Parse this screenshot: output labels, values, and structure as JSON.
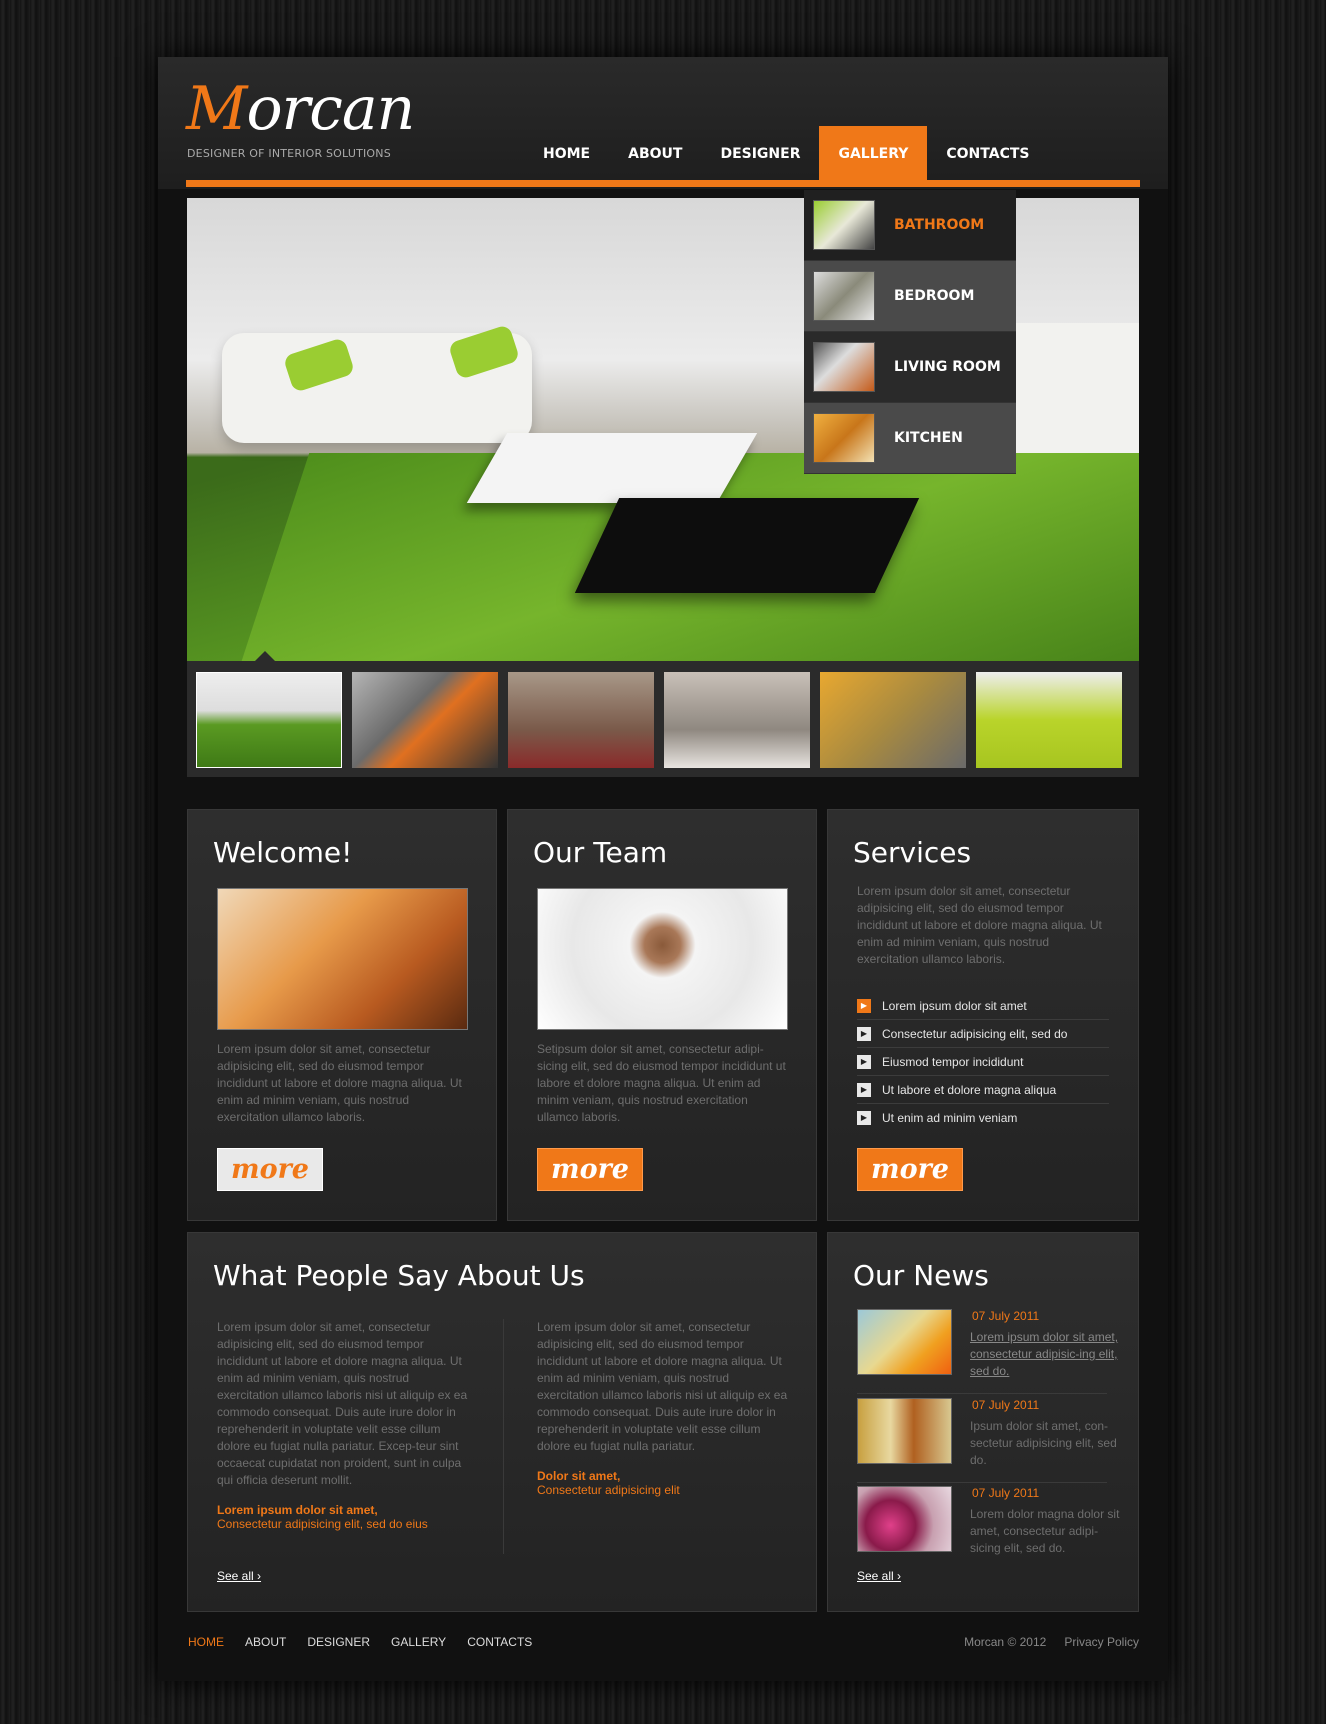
{
  "brand": {
    "name": "Morcan",
    "initial": "M",
    "rest": "orcan",
    "tagline": "DESIGNER OF INTERIOR SOLUTIONS",
    "accent": "#f07818"
  },
  "nav": {
    "items": [
      "HOME",
      "ABOUT",
      "DESIGNER",
      "GALLERY",
      "CONTACTS"
    ],
    "active": "GALLERY"
  },
  "gallery_menu": {
    "items": [
      "BATHROOM",
      "BEDROOM",
      "LIVING ROOM",
      "KITCHEN"
    ],
    "highlighted": "BATHROOM"
  },
  "welcome": {
    "title": "Welcome!",
    "text": "Lorem ipsum dolor sit amet, consectetur adipisicing elit, sed do eiusmod tempor incididunt ut labore et dolore magna aliqua. Ut enim ad minim veniam, quis nostrud exercitation ullamco laboris.",
    "more": "more"
  },
  "team": {
    "title": "Our Team",
    "text": "Setipsum dolor sit amet, consectetur adipi-sicing elit, sed do eiusmod tempor incididunt ut labore et dolore magna aliqua. Ut enim ad minim veniam, quis nostrud exercitation ullamco laboris.",
    "more": "more"
  },
  "services": {
    "title": "Services",
    "text": "Lorem ipsum dolor sit amet, consectetur adipisicing elit, sed do eiusmod tempor incididunt ut labore et dolore magna aliqua. Ut enim ad minim veniam, quis nostrud exercitation ullamco laboris.",
    "items": [
      "Lorem ipsum dolor sit amet",
      "Consectetur adipisicing elit, sed do",
      "Eiusmod tempor incididunt",
      "Ut labore et dolore magna aliqua",
      "Ut enim ad minim veniam"
    ],
    "more": "more"
  },
  "testimonials": {
    "title": "What People Say About Us",
    "items": [
      {
        "text": "Lorem ipsum dolor sit amet, consectetur adipisicing elit, sed do eiusmod tempor incididunt ut labore et dolore magna aliqua. Ut enim ad minim veniam, quis nostrud exercitation ullamco laboris nisi ut aliquip ex ea commodo consequat. Duis aute irure dolor in reprehenderit in voluptate velit esse cillum dolore eu fugiat nulla pariatur. Excep-teur sint occaecat cupidatat non proident, sunt in culpa qui officia deserunt mollit.",
        "author": "Lorem ipsum dolor sit amet,",
        "author_sub": "Consectetur adipisicing elit, sed do eius"
      },
      {
        "text": "Lorem ipsum dolor sit amet, consectetur adipisicing elit, sed do eiusmod tempor incididunt ut labore et dolore magna aliqua. Ut enim ad minim veniam, quis nostrud exercitation ullamco laboris nisi ut aliquip ex ea commodo consequat. Duis aute irure dolor in reprehenderit in voluptate velit esse cillum dolore eu fugiat nulla pariatur.",
        "author": "Dolor sit amet,",
        "author_sub": "Consectetur adipisicing elit"
      }
    ],
    "see_all": "See all ›"
  },
  "news": {
    "title": "Our News",
    "items": [
      {
        "date": "07 July 2011",
        "text": "Lorem ipsum dolor sit amet, consectetur adipisic-ing elit, sed do."
      },
      {
        "date": "07 July 2011",
        "text": "Ipsum dolor sit amet, con-sectetur adipisicing elit, sed do."
      },
      {
        "date": "07 July 2011",
        "text": "Lorem dolor magna dolor sit amet, consectetur adipi-sicing elit, sed do."
      }
    ],
    "see_all": "See all ›"
  },
  "footer": {
    "nav": [
      "HOME",
      "ABOUT",
      "DESIGNER",
      "GALLERY",
      "CONTACTS"
    ],
    "copyright": "Morcan © 2012",
    "privacy": "Privacy Policy"
  }
}
